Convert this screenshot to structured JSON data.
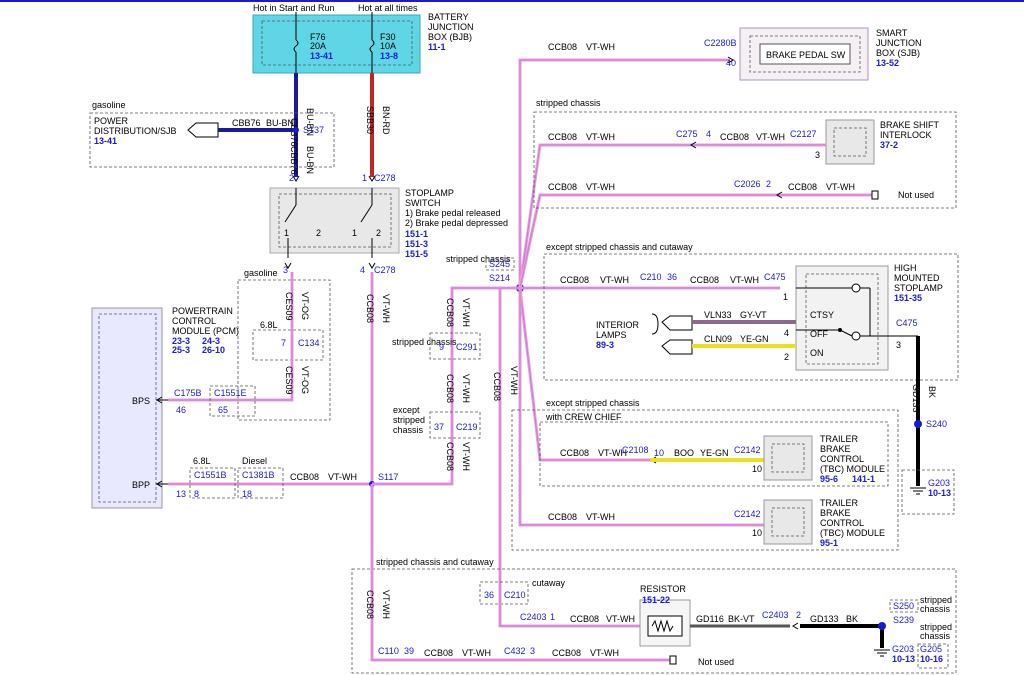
{
  "bjb": {
    "top_left_label": "Hot in Start and Run",
    "top_right_label": "Hot at all times",
    "fuse1_name": "F76",
    "fuse1_amp": "20A",
    "fuse1_ref": "13-41",
    "fuse2_name": "F30",
    "fuse2_amp": "10A",
    "fuse2_ref": "13-8",
    "title_line1": "BATTERY",
    "title_line2": "JUNCTION",
    "title_line3": "BOX (BJB)",
    "ref": "11-1"
  },
  "sjb": {
    "title_line1": "SMART",
    "title_line2": "JUNCTION",
    "title_line3": "BOX (SJB)",
    "ref": "13-52",
    "inner": "BRAKE PEDAL SW",
    "connector": "C2280B",
    "pin": "40"
  },
  "power_dist": {
    "region": "gasoline",
    "line1": "POWER",
    "line2": "DISTRIBUTION/SJB",
    "ref": "13-41",
    "wire": "CBB76",
    "color": "BU-BN",
    "splice": "S137"
  },
  "wires_top": {
    "cbb76": "CBB76",
    "bu_bn": "BU-BN",
    "sbb30": "SBB30",
    "bn_rd": "BN-RD",
    "pin2": "2",
    "pin1": "1",
    "c278": "C278"
  },
  "stoplamp": {
    "line1": "STOPLAMP",
    "line2": "SWITCH",
    "note1": "1) Brake pedal released",
    "note2": "2) Brake pedal depressed",
    "ref1": "151-1",
    "ref2": "151-3",
    "ref3": "151-5",
    "pin3": "3",
    "pin4": "4",
    "c278b": "C278"
  },
  "pcm": {
    "line1": "POWERTRAIN",
    "line2": "CONTROL",
    "line3": "MODULE (PCM)",
    "refa": "23-3",
    "refb": "24-3",
    "refc": "25-3",
    "refd": "26-10",
    "bps": "BPS",
    "bpp": "BPP"
  },
  "gasoline_region": {
    "label": "gasoline",
    "engine": "6.8L",
    "ces09": "CES09",
    "vt_og": "VT-OG",
    "pin7": "7",
    "c134": "C134",
    "c1551e": "C1551E",
    "pin65": "65",
    "c175b": "C175B",
    "pin46": "46"
  },
  "bpp_row": {
    "engine": "6.8L",
    "diesel": "Diesel",
    "c1551b": "C1551B",
    "c1381b": "C1381B",
    "wire": "CCB08",
    "color": "VT-WH",
    "splice": "S117",
    "pin13": "13",
    "pin8": "8",
    "pin18": "18"
  },
  "center": {
    "ccb08": "CCB08",
    "vt_wh": "VT-WH",
    "stripped_chassis": "stripped chassis",
    "s245": "S245",
    "s214": "S214",
    "pin9": "9",
    "c291": "C291",
    "except_line1": "except",
    "except_line2": "stripped",
    "except_line3": "chassis",
    "pin37": "37",
    "c219": "C219"
  },
  "brake_shift": {
    "region": "stripped chassis",
    "line1": "BRAKE SHIFT",
    "line2": "INTERLOCK",
    "ref": "37-2",
    "c275": "C275",
    "pin4": "4",
    "c2127": "C2127",
    "pin3": "3",
    "c2026": "C2026",
    "pin2": "2",
    "not_used": "Not used"
  },
  "hmsl": {
    "region": "except stripped chassis and cutaway",
    "line1": "HIGH",
    "line2": "MOUNTED",
    "line3": "STOPLAMP",
    "ref": "151-35",
    "c210": "C210",
    "pin36": "36",
    "c475": "C475",
    "pin1": "1",
    "pin4": "4",
    "pin2": "2",
    "pin3": "3",
    "ctsy": "CTSY",
    "off": "OFF",
    "on": "ON",
    "interior1": "INTERIOR",
    "interior2": "LAMPS",
    "interior_ref": "89-3",
    "vln33": "VLN33",
    "gy_vt": "GY-VT",
    "cln09": "CLN09",
    "ye_gn": "YE-GN",
    "gd133": "GD133",
    "bk": "BK",
    "s240": "S240",
    "g203": "G203",
    "g203_ref": "10-13"
  },
  "tbc1": {
    "region1": "except stripped chassis",
    "region2": "with CREW CHIEF",
    "line1": "TRAILER",
    "line2": "BRAKE",
    "line3": "CONTROL",
    "line4": "(TBC) MODULE",
    "ref": "141-1",
    "ref2": "95-6",
    "c2108": "C2108",
    "pin10a": "10",
    "boo": "BOO",
    "ye_gn": "YE-GN",
    "c2142": "C2142",
    "pin10b": "10"
  },
  "tbc2": {
    "line1": "TRAILER",
    "line2": "BRAKE",
    "line3": "CONTROL",
    "line4": "(TBC) MODULE",
    "ref": "95-1",
    "c2142": "C2142",
    "pin10": "10"
  },
  "bottom": {
    "region": "stripped chassis and cutaway",
    "cutaway": "cutaway",
    "pin36": "36",
    "c210": "C210",
    "c2403a": "C2403",
    "pin1": "1",
    "resistor": "RESISTOR",
    "resistor_ref": "151-22",
    "gd116": "GD116",
    "bk_vt": "BK-VT",
    "c2403b": "C2403",
    "pin2": "2",
    "gd133": "GD133",
    "bk": "BK",
    "s250": "S250",
    "s239": "S239",
    "stripped1": "stripped",
    "chassis1": "chassis",
    "stripped2": "stripped",
    "chassis2": "chassis",
    "g203": "G203",
    "g203_ref": "10-13",
    "g205": "G205",
    "g205_ref": "10-16",
    "c110": "C110",
    "pin39": "39",
    "c432": "C432",
    "pin3": "3",
    "not_used": "Not used"
  },
  "colors": {
    "pink": "#e6a0e0",
    "blue": "#1a1ad0",
    "red": "#c02828",
    "yellow": "#e8e020",
    "cyan": "#5fd6e6",
    "black": "#000000",
    "navy": "#1a1a9a"
  }
}
